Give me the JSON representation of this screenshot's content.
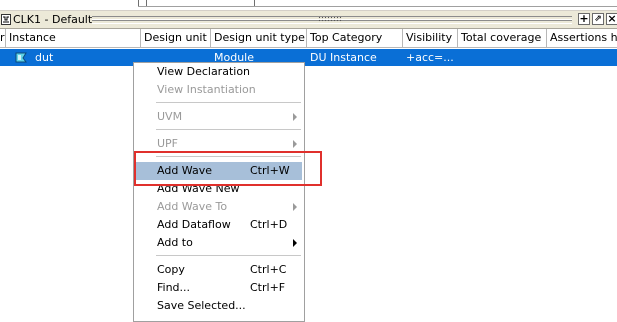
{
  "window": {
    "title": "CLK1 - Default",
    "icon": "wave-window-icon",
    "buttons": [
      {
        "name": "add-pane-button",
        "symbol": "+"
      },
      {
        "name": "undock-button",
        "symbol": "⇗"
      },
      {
        "name": "close-button",
        "symbol": "×"
      }
    ]
  },
  "table": {
    "columns": [
      "Instance",
      "Design unit",
      "Design unit type",
      "Top Category",
      "Visibility",
      "Total coverage",
      "Assertions hit"
    ],
    "left_marker": "r",
    "row": {
      "instance": "dut",
      "design_unit": "",
      "design_unit_type": "Module",
      "top_category": "DU Instance",
      "visibility": "+acc=..."
    }
  },
  "context_menu": {
    "items": [
      {
        "label": "View Declaration",
        "shortcut": "",
        "disabled": false,
        "submenu": false
      },
      {
        "label": "View Instantiation",
        "shortcut": "",
        "disabled": true,
        "submenu": false
      },
      {
        "label": "UVM",
        "shortcut": "",
        "disabled": true,
        "submenu": true
      },
      {
        "label": "UPF",
        "shortcut": "",
        "disabled": true,
        "submenu": true
      },
      {
        "label": "Add Wave",
        "shortcut": "Ctrl+W",
        "disabled": false,
        "submenu": false,
        "highlighted": true
      },
      {
        "label": "Add Wave New",
        "shortcut": "",
        "disabled": false,
        "submenu": false
      },
      {
        "label": "Add Wave To",
        "shortcut": "",
        "disabled": true,
        "submenu": true
      },
      {
        "label": "Add Dataflow",
        "shortcut": "Ctrl+D",
        "disabled": false,
        "submenu": false
      },
      {
        "label": "Add to",
        "shortcut": "",
        "disabled": false,
        "submenu": true
      },
      {
        "label": "Copy",
        "shortcut": "Ctrl+C",
        "disabled": false,
        "submenu": false
      },
      {
        "label": "Find...",
        "shortcut": "Ctrl+F",
        "disabled": false,
        "submenu": false
      },
      {
        "label": "Save Selected...",
        "shortcut": "",
        "disabled": false,
        "submenu": false
      }
    ]
  },
  "colors": {
    "selection": "#0a6fd6",
    "menu_highlight": "#a7bfd9",
    "annotation_box": "#e0302c",
    "disabled_text": "#9a9a9a"
  }
}
